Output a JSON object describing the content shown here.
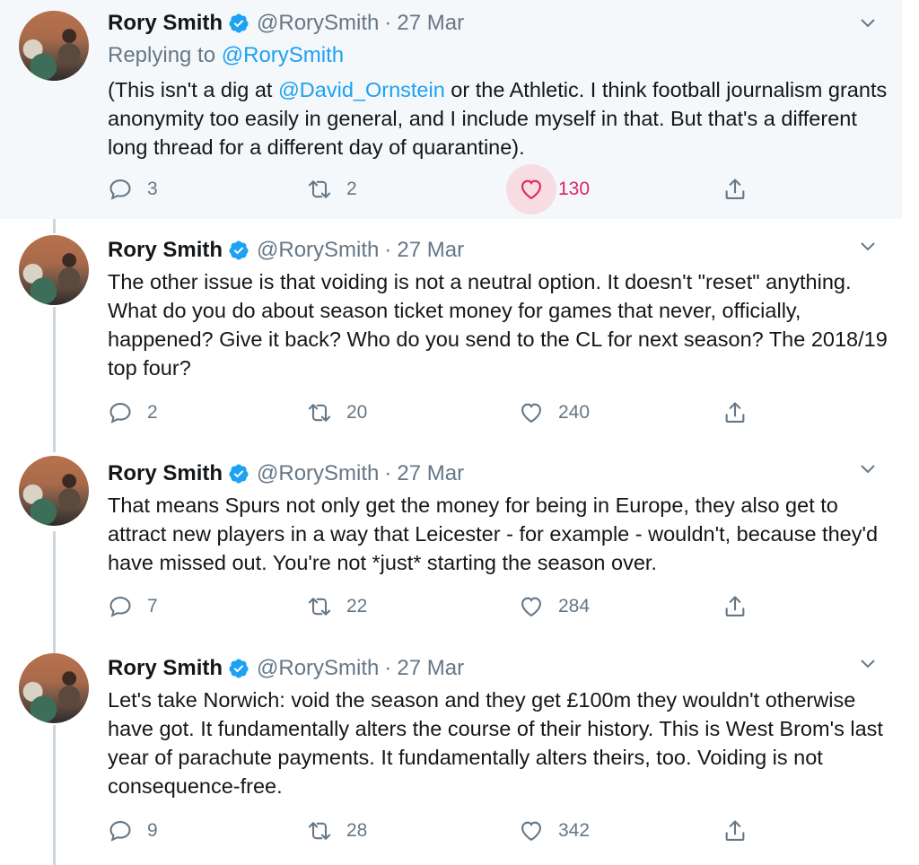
{
  "tweets": [
    {
      "name": "Rory Smith",
      "handle": "@RorySmith",
      "dot": "·",
      "date": "27 Mar",
      "replying_label": "Replying to",
      "replying_to": "@RorySmith",
      "text_parts": [
        "(This isn't a dig at ",
        "@David_Ornstein",
        " or the Athletic. I think football journalism grants anonymity too easily in general, and I include myself in that. But that's a different long thread for a different day of quarantine)."
      ],
      "replies": "3",
      "retweets": "2",
      "likes": "130",
      "liked": true
    },
    {
      "name": "Rory Smith",
      "handle": "@RorySmith",
      "dot": "·",
      "date": "27 Mar",
      "text": "The other issue is that voiding is not a neutral option. It doesn't \"reset\" anything. What do you do about season ticket money for games that never, officially, happened? Give it back? Who do you send to the CL for next season? The 2018/19 top four?",
      "replies": "2",
      "retweets": "20",
      "likes": "240"
    },
    {
      "name": "Rory Smith",
      "handle": "@RorySmith",
      "dot": "·",
      "date": "27 Mar",
      "text": "That means Spurs not only get the money for being in Europe, they also get to attract new players in a way that Leicester - for example - wouldn't, because they'd have missed out. You're not *just* starting the season over.",
      "replies": "7",
      "retweets": "22",
      "likes": "284"
    },
    {
      "name": "Rory Smith",
      "handle": "@RorySmith",
      "dot": "·",
      "date": "27 Mar",
      "text": "Let's take Norwich: void the season and they get £100m they wouldn't otherwise have got. It fundamentally alters the course of their history. This is West Brom's last year of parachute payments. It fundamentally alters theirs, too. Voiding is not consequence-free.",
      "replies": "9",
      "retweets": "28",
      "likes": "342"
    }
  ],
  "colors": {
    "accent": "#1da1f2",
    "like": "#e0245e",
    "muted": "#657786",
    "highlight_bg": "#f5f8fa"
  },
  "icons": {
    "verified": "verified-badge-icon",
    "caret": "chevron-down-icon",
    "reply": "reply-icon",
    "retweet": "retweet-icon",
    "like": "heart-icon",
    "share": "share-icon"
  }
}
